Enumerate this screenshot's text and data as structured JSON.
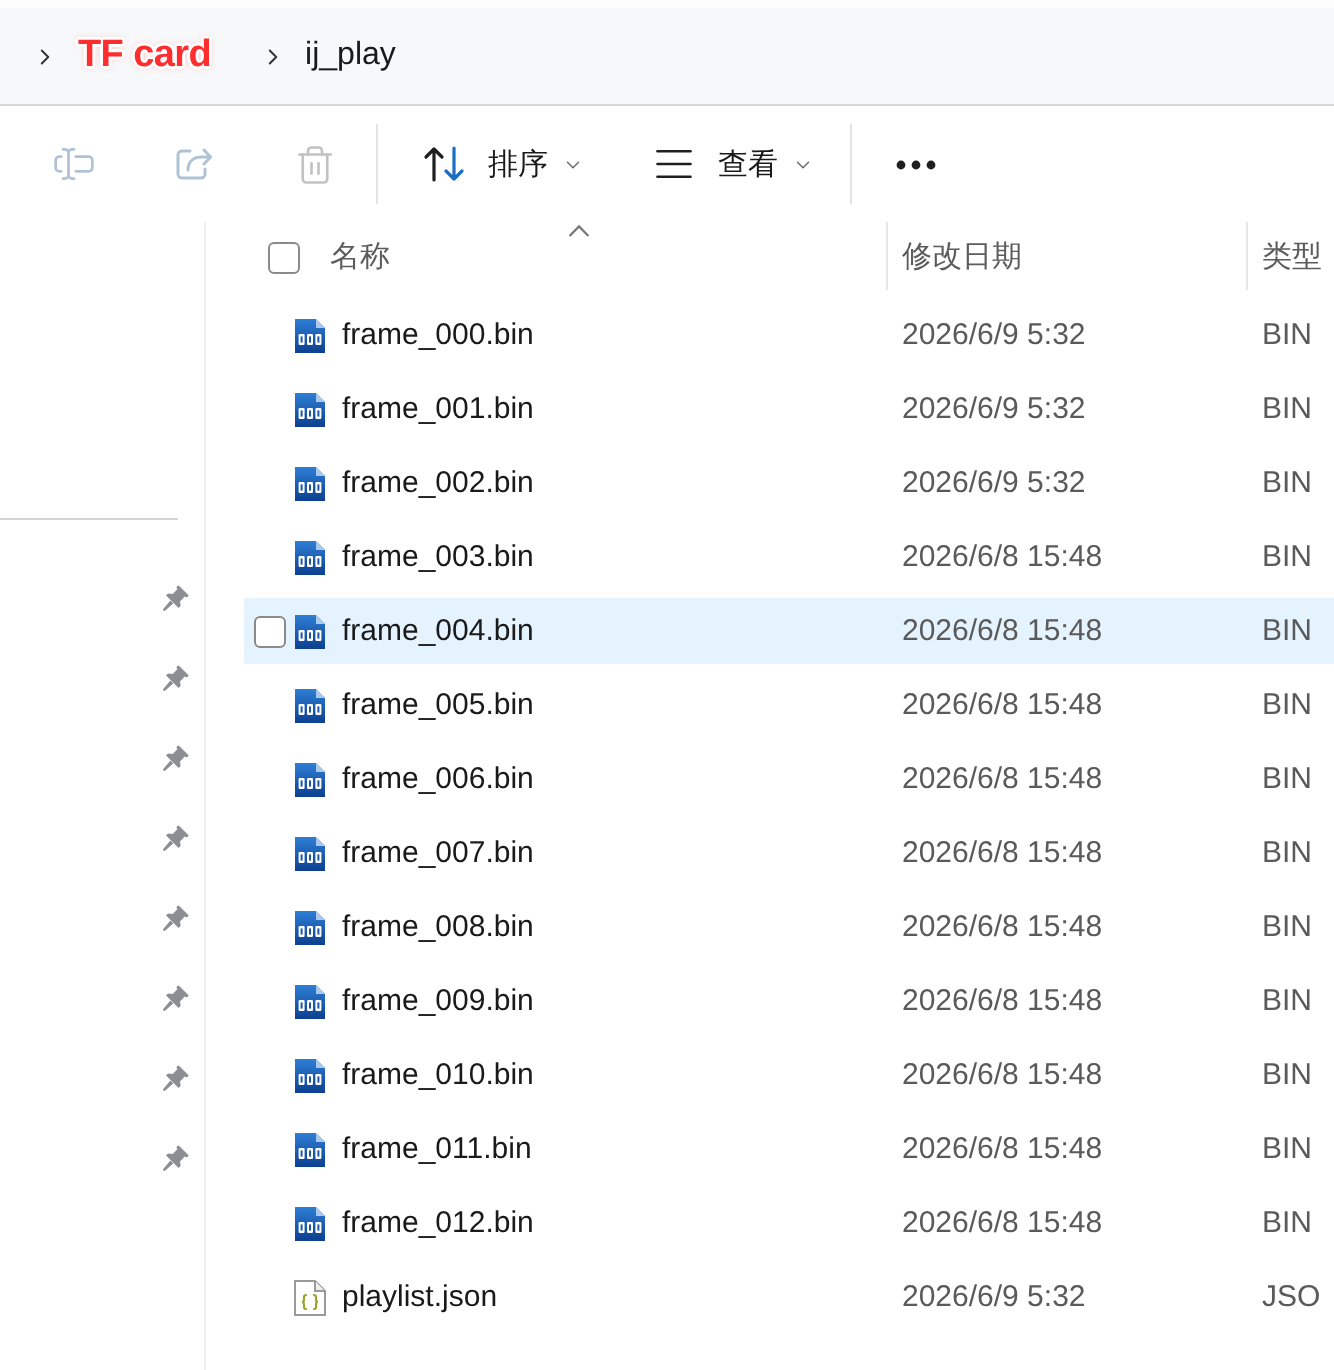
{
  "address_bar": {
    "crumbs": [
      {
        "label": "TF card",
        "kind": "annotated"
      },
      {
        "label": "ij_play",
        "kind": "plain"
      }
    ]
  },
  "toolbar": {
    "items": [
      {
        "kind": "rename",
        "disabled": true
      },
      {
        "kind": "share",
        "disabled": true
      },
      {
        "kind": "delete",
        "disabled": true
      },
      {
        "kind": "separator"
      },
      {
        "kind": "sort",
        "label": "排序",
        "disabled": false
      },
      {
        "kind": "view",
        "label": "查看",
        "disabled": false
      },
      {
        "kind": "separator"
      },
      {
        "kind": "more",
        "disabled": false
      }
    ]
  },
  "sidebar": {
    "items": [
      {
        "pinned": true
      },
      {
        "pinned": true
      },
      {
        "pinned": true
      },
      {
        "pinned": true
      },
      {
        "pinned": true
      },
      {
        "pinned": true
      },
      {
        "pinned": true
      },
      {
        "pinned": true
      }
    ]
  },
  "file_list": {
    "select_all": {
      "checked": false
    },
    "columns": [
      {
        "label": "名称",
        "sorted": true
      },
      {
        "label": "修改日期",
        "sorted": false
      },
      {
        "label": "类型",
        "sorted": false
      }
    ],
    "rows": [
      {
        "name": "frame_000.bin",
        "modified": "2026/6/9 5:32",
        "type": "BIN",
        "kind": "bin",
        "hovered": false
      },
      {
        "name": "frame_001.bin",
        "modified": "2026/6/9 5:32",
        "type": "BIN",
        "kind": "bin",
        "hovered": false
      },
      {
        "name": "frame_002.bin",
        "modified": "2026/6/9 5:32",
        "type": "BIN",
        "kind": "bin",
        "hovered": false
      },
      {
        "name": "frame_003.bin",
        "modified": "2026/6/8 15:48",
        "type": "BIN",
        "kind": "bin",
        "hovered": false
      },
      {
        "name": "frame_004.bin",
        "modified": "2026/6/8 15:48",
        "type": "BIN",
        "kind": "bin",
        "hovered": true
      },
      {
        "name": "frame_005.bin",
        "modified": "2026/6/8 15:48",
        "type": "BIN",
        "kind": "bin",
        "hovered": false
      },
      {
        "name": "frame_006.bin",
        "modified": "2026/6/8 15:48",
        "type": "BIN",
        "kind": "bin",
        "hovered": false
      },
      {
        "name": "frame_007.bin",
        "modified": "2026/6/8 15:48",
        "type": "BIN",
        "kind": "bin",
        "hovered": false
      },
      {
        "name": "frame_008.bin",
        "modified": "2026/6/8 15:48",
        "type": "BIN",
        "kind": "bin",
        "hovered": false
      },
      {
        "name": "frame_009.bin",
        "modified": "2026/6/8 15:48",
        "type": "BIN",
        "kind": "bin",
        "hovered": false
      },
      {
        "name": "frame_010.bin",
        "modified": "2026/6/8 15:48",
        "type": "BIN",
        "kind": "bin",
        "hovered": false
      },
      {
        "name": "frame_011.bin",
        "modified": "2026/6/8 15:48",
        "type": "BIN",
        "kind": "bin",
        "hovered": false
      },
      {
        "name": "frame_012.bin",
        "modified": "2026/6/8 15:48",
        "type": "BIN",
        "kind": "bin",
        "hovered": false
      },
      {
        "name": "playlist.json",
        "modified": "2026/6/9 5:32",
        "type": "JSO",
        "kind": "json",
        "hovered": false
      }
    ]
  }
}
